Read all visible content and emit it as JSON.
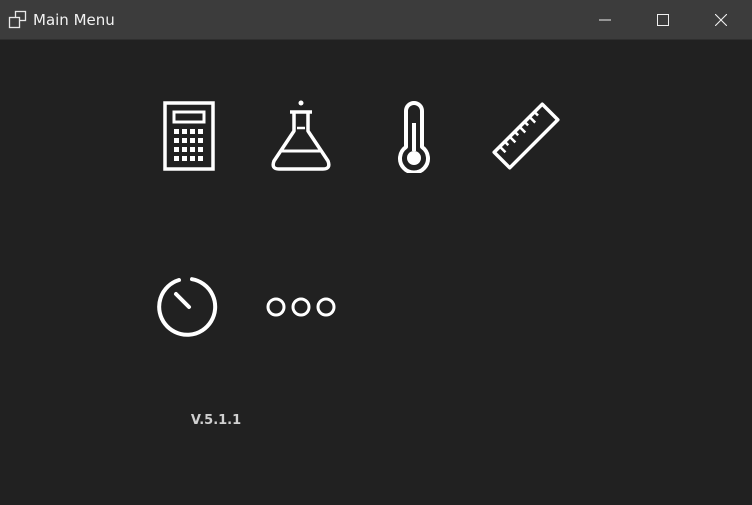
{
  "window": {
    "title": "Main Menu",
    "icon": "window-restore-icon",
    "controls": [
      "minimize",
      "maximize",
      "close"
    ]
  },
  "menu": {
    "row1": [
      {
        "name": "calculator",
        "icon": "calculator-icon"
      },
      {
        "name": "chemistry",
        "icon": "flask-icon"
      },
      {
        "name": "temperature",
        "icon": "thermometer-icon"
      },
      {
        "name": "measurement",
        "icon": "ruler-icon"
      }
    ],
    "row2": [
      {
        "name": "timer",
        "icon": "timer-icon"
      },
      {
        "name": "more",
        "icon": "more-icon"
      }
    ]
  },
  "version": "V.5.1.1",
  "colors": {
    "titlebar": "#3c3c3c",
    "background": "#212121",
    "icon": "#ffffff",
    "version_text": "#d0d0d0"
  }
}
